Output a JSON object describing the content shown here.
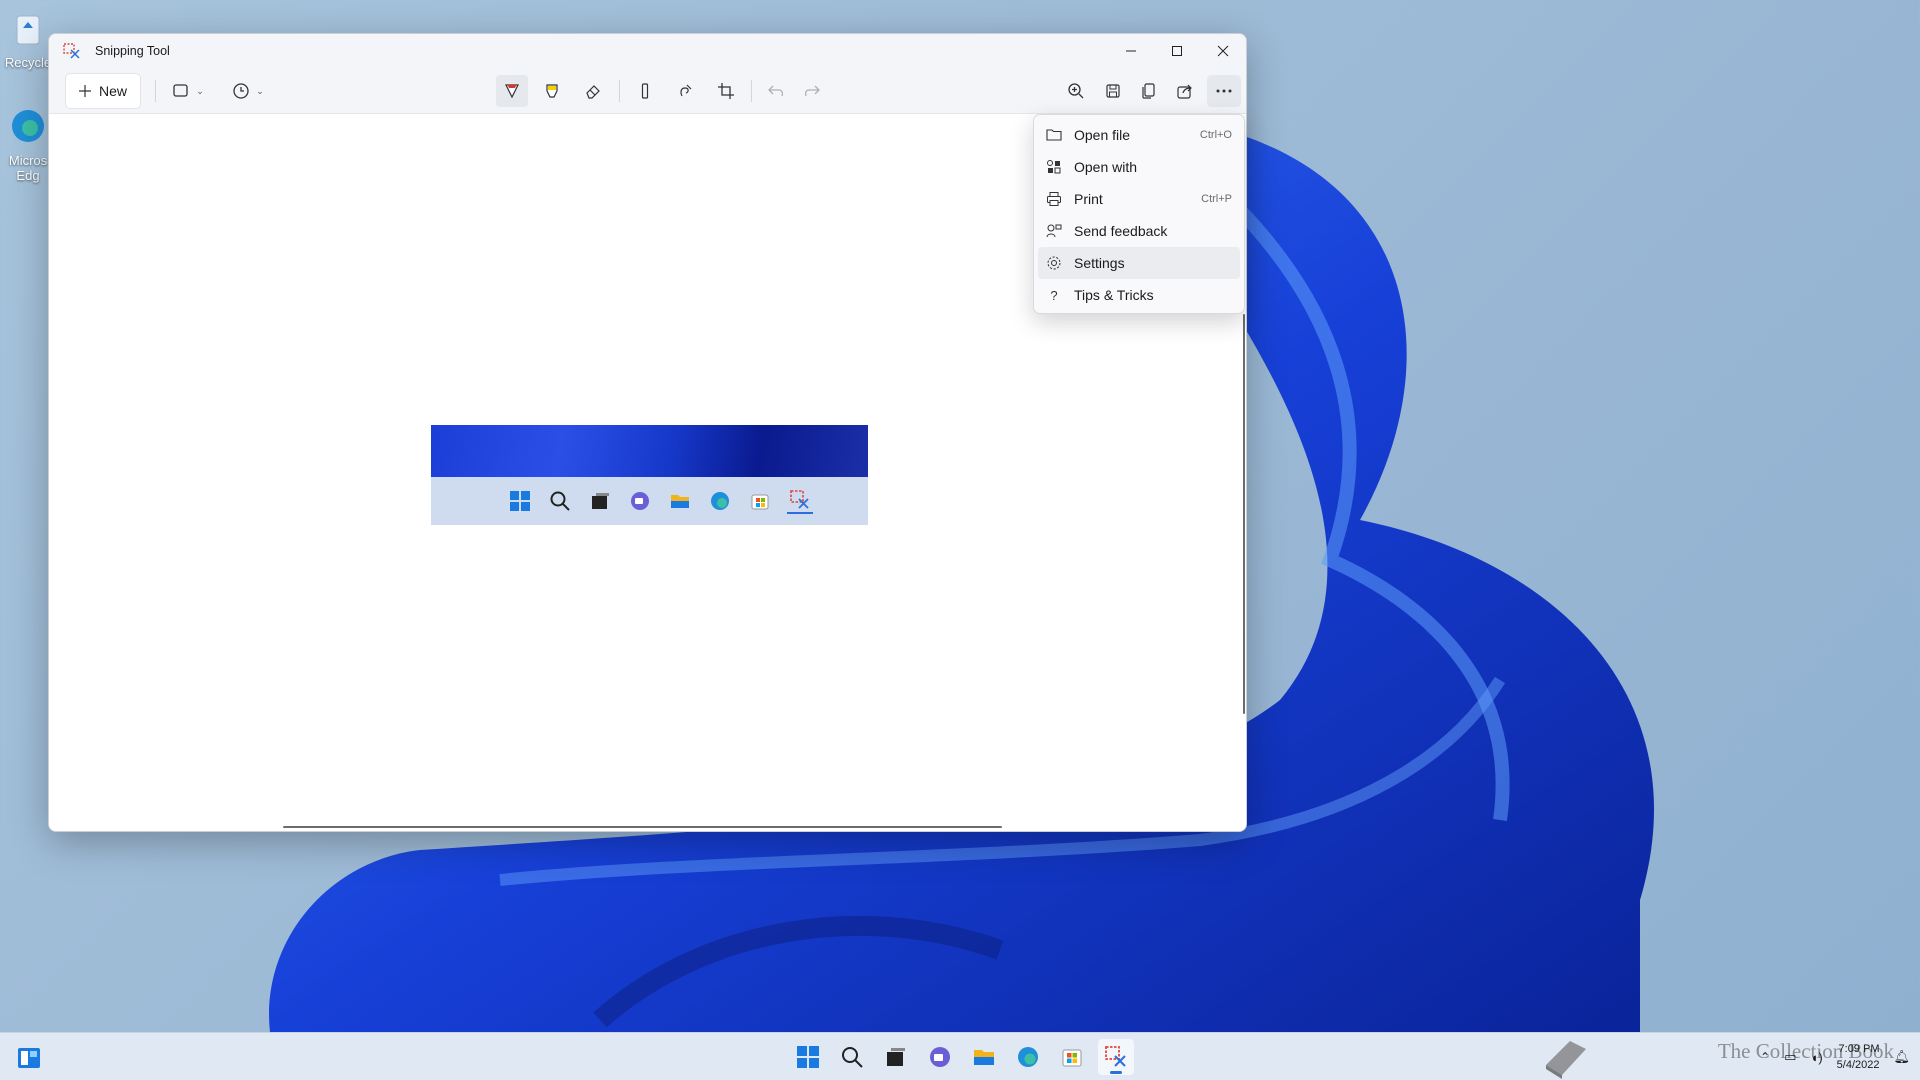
{
  "window": {
    "title": "Snipping Tool",
    "new_label": "New"
  },
  "menu": {
    "items": [
      {
        "label": "Open file",
        "shortcut": "Ctrl+O",
        "icon": "folder-icon"
      },
      {
        "label": "Open with",
        "shortcut": "",
        "icon": "open-with-icon"
      },
      {
        "label": "Print",
        "shortcut": "Ctrl+P",
        "icon": "printer-icon"
      },
      {
        "label": "Send feedback",
        "shortcut": "",
        "icon": "feedback-icon"
      },
      {
        "label": "Settings",
        "shortcut": "",
        "icon": "gear-icon"
      },
      {
        "label": "Tips & Tricks",
        "shortcut": "",
        "icon": "question-icon"
      }
    ]
  },
  "desktop": {
    "icons": [
      {
        "label": "Recycle",
        "icon": "recycle-bin-icon"
      },
      {
        "label": "Micros Edg",
        "icon": "edge-icon"
      }
    ]
  },
  "taskbar": {
    "apps": [
      "start-icon",
      "search-icon",
      "task-view-icon",
      "chat-icon",
      "file-explorer-icon",
      "edge-icon",
      "store-icon",
      "snipping-tool-icon"
    ],
    "clock_time": "7:09 PM",
    "clock_date": "5/4/2022",
    "watermark": "The Collection Book"
  },
  "colors": {
    "accent": "#2b6fdd",
    "wallpaper": "#1d46d6"
  }
}
